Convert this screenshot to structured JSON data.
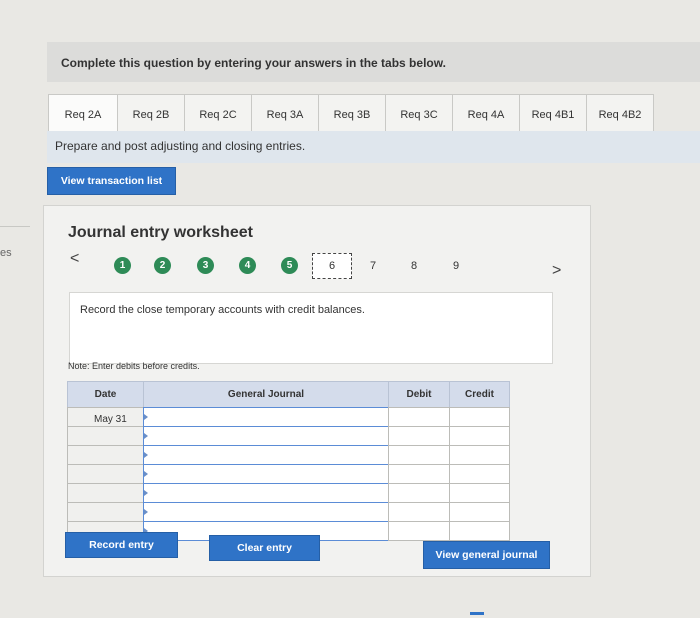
{
  "side": {
    "fragment": "es"
  },
  "header": {
    "instruction": "Complete this question by entering your answers in the tabs below."
  },
  "tabs": [
    {
      "label": "Req 2A"
    },
    {
      "label": "Req 2B"
    },
    {
      "label": "Req 2C"
    },
    {
      "label": "Req 3A"
    },
    {
      "label": "Req 3B"
    },
    {
      "label": "Req 3C"
    },
    {
      "label": "Req 4A"
    },
    {
      "label": "Req 4B1"
    },
    {
      "label": "Req 4B2"
    }
  ],
  "instructions": {
    "text": "Prepare and post adjusting and closing entries."
  },
  "buttons": {
    "view_transactions": "View transaction list",
    "record_entry": "Record entry",
    "clear_entry": "Clear entry",
    "view_general_journal": "View general journal"
  },
  "worksheet": {
    "title": "Journal entry worksheet",
    "prev_arrow": "<",
    "next_arrow": ">",
    "steps": [
      "1",
      "2",
      "3",
      "4",
      "5",
      "6",
      "7",
      "8",
      "9"
    ],
    "current_step": "6",
    "description": "Record the close temporary accounts with credit balances.",
    "note": "Note: Enter debits before credits."
  },
  "table": {
    "headers": {
      "date": "Date",
      "journal": "General Journal",
      "debit": "Debit",
      "credit": "Credit"
    },
    "first_date": "May 31"
  },
  "colors": {
    "button": "#2f73c7",
    "step_done": "#2e8b57",
    "header_row": "#d4dceb"
  }
}
